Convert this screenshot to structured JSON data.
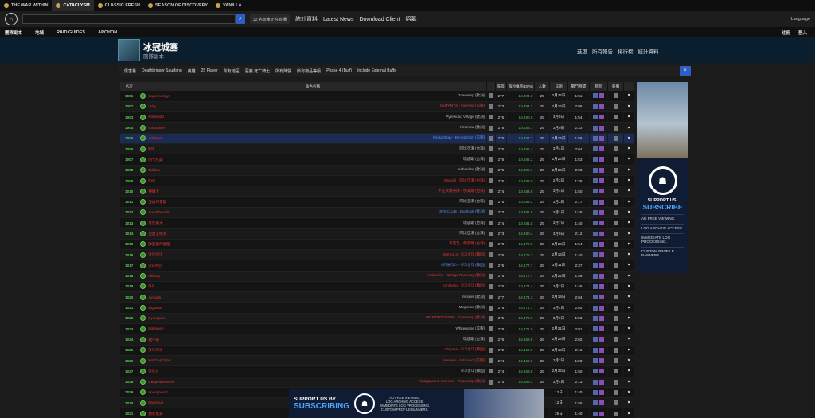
{
  "topbar": {
    "items": [
      {
        "label": "THE WAR WITHIN",
        "active": false
      },
      {
        "label": "CATACLYSM",
        "active": true
      },
      {
        "label": "CLASSIC FRESH",
        "active": false
      },
      {
        "label": "SEASON OF DISCOVERY",
        "active": false
      },
      {
        "label": "VANILLA",
        "active": false
      }
    ]
  },
  "mainnav": {
    "live": "32 名玩家正在直播",
    "links": [
      "統計資料",
      "Latest News",
      "Download Client",
      "招募"
    ],
    "language": "Language"
  },
  "subnav": {
    "items": [
      "團隊副本",
      "地城",
      "RAID GUIDES",
      "ARCHON"
    ],
    "right": [
      "註冊",
      "登入"
    ]
  },
  "zone": {
    "title": "冰冠城塞",
    "subtitle": "團隊副本",
    "links": [
      "進度",
      "所有報告",
      "排行榜",
      "統計資料"
    ]
  },
  "filters": [
    "傷害量",
    "Deathbringer Saurfang",
    "英雄",
    "25 Player",
    "所有地區",
    "惡魔 死亡騎士",
    "所有陣營",
    "所有物品等級",
    "Phase 4 (Buff)",
    "Include External Buffs"
  ],
  "table": {
    "headers": [
      "名次",
      "角色名稱",
      "",
      "裝等",
      "每秒傷害(DPS)",
      "人數",
      "日期",
      "戰鬥時間",
      "飾品",
      "裝備",
      ""
    ],
    "rows": [
      {
        "rank": "1001",
        "name": "Варсзлепрус",
        "guild": "Пламегор (歐洲)",
        "gc": "",
        "ilvl": "277",
        "dps": "19,494.8",
        "n": "25",
        "date": "2月22日",
        "time": "1:51"
      },
      {
        "rank": "1002",
        "name": "Lolly",
        "guild": "MUTANTS - Faerlina (美服)",
        "gc": "red",
        "ilvl": "273",
        "dps": "19,494.2",
        "n": "25",
        "date": "2月16日",
        "time": "2:06"
      },
      {
        "rank": "1003",
        "name": "Dotksadd",
        "guild": "Pyrewood Village (歐洲)",
        "gc": "",
        "ilvl": "276",
        "dps": "19,490.8",
        "n": "25",
        "date": "3月8日",
        "time": "1:54"
      },
      {
        "rank": "1004",
        "name": "Rotocarile",
        "guild": "Firemaw (歐洲)",
        "gc": "",
        "ilvl": "276",
        "dps": "19,488.7",
        "n": "25",
        "date": "3月9日",
        "time": "2:22"
      },
      {
        "rank": "1005",
        "name": "Arthemm",
        "guild": "Kinda Okay - Benediction (美服)",
        "gc": "blue",
        "ilvl": "275",
        "dps": "19,487.2",
        "n": "25",
        "date": "2月14日",
        "time": "1:56",
        "hl": true
      },
      {
        "rank": "1006",
        "name": "Bell",
        "guild": "阿比亞漢 (台灣)",
        "gc": "",
        "ilvl": "275",
        "dps": "19,486.4",
        "n": "25",
        "date": "3月4日",
        "time": "2:04"
      },
      {
        "rank": "1007",
        "name": "阿卡托斯",
        "guild": "瑞迪斯 (台灣)",
        "gc": "",
        "ilvl": "276",
        "dps": "19,486.2",
        "n": "25",
        "date": "2月24日",
        "time": "1:53"
      },
      {
        "rank": "1008",
        "name": "Elddea",
        "guild": "Ashenline (歐洲)",
        "gc": "",
        "ilvl": "276",
        "dps": "19,485.1",
        "n": "25",
        "date": "2月26日",
        "time": "2:03"
      },
      {
        "rank": "1009",
        "name": "Ryd",
        "guild": "Mandel - 阿比亞漢 (台灣)",
        "gc": "red",
        "ilvl": "275",
        "dps": "19,483.8",
        "n": "25",
        "date": "2月2日",
        "time": "1:38"
      },
      {
        "rank": "1010",
        "name": "神騎士",
        "guild": "不正式精英隊 - 伊美爾 (台灣)",
        "gc": "red",
        "ilvl": "274",
        "dps": "19,483.8",
        "n": "25",
        "date": "3月4日",
        "time": "1:50"
      },
      {
        "rank": "1011",
        "name": "亞伯特雷斯",
        "guild": "阿比亞漢 (台灣)",
        "gc": "",
        "ilvl": "276",
        "dps": "19,483.2",
        "n": "25",
        "date": "3月3日",
        "time": "2:17"
      },
      {
        "rank": "1012",
        "name": "Anankhevink",
        "guild": "DPS CLUB - Everlook (歐洲)",
        "gc": "blue",
        "ilvl": "273",
        "dps": "19,481.6",
        "n": "25",
        "date": "3月1日",
        "time": "1:46"
      },
      {
        "rank": "1013",
        "name": "死死雷夫",
        "guild": "瑞迪斯 (台灣)",
        "gc": "",
        "ilvl": "274",
        "dps": "19,481.5",
        "n": "25",
        "date": "3月7日",
        "time": "1:40"
      },
      {
        "rank": "1014",
        "name": "亞瑟王傑克",
        "guild": "阿比亞漢 (台灣)",
        "gc": "",
        "ilvl": "273",
        "dps": "19,480.4",
        "n": "25",
        "date": "3月9日",
        "time": "2:12"
      },
      {
        "rank": "1015",
        "name": "歐西斯的覺醒",
        "guild": "不吃乳 - 伊美爾 (台灣)",
        "gc": "red",
        "ilvl": "278",
        "dps": "19,478.8",
        "n": "25",
        "date": "2月24日",
        "time": "1:54"
      },
      {
        "rank": "1016",
        "name": "아이우터",
        "guild": "Eternal 2 - 로크골다 (韓國)",
        "gc": "red",
        "ilvl": "276",
        "dps": "19,478.2",
        "n": "25",
        "date": "2月16日",
        "time": "1:40"
      },
      {
        "rank": "1017",
        "name": "마로트린",
        "guild": "세이몰리스 - 로크골다 (韓國)",
        "gc": "blue",
        "ilvl": "276",
        "dps": "19,477.7",
        "n": "25",
        "date": "3月11日",
        "time": "2:37"
      },
      {
        "rank": "1018",
        "name": "Aliburg",
        "guild": "Avalanche - Mirage Raceway (歐洲)",
        "gc": "red",
        "ilvl": "275",
        "dps": "19,477.7",
        "n": "25",
        "date": "2月22日",
        "time": "1:56"
      },
      {
        "rank": "1019",
        "name": "타로",
        "guild": "Ironlineto - 로크골다 (韓國)",
        "gc": "red",
        "ilvl": "276",
        "dps": "19,474.4",
        "n": "25",
        "date": "3月7日",
        "time": "1:46"
      },
      {
        "rank": "1020",
        "name": "Aircardi",
        "guild": "Venoxis (歐洲)",
        "gc": "",
        "ilvl": "277",
        "dps": "19,474.3",
        "n": "25",
        "date": "2月19日",
        "time": "2:04"
      },
      {
        "rank": "1021",
        "name": "BigBass",
        "guild": "Mograine (歐洲)",
        "gc": "",
        "ilvl": "276",
        "dps": "19,474.1",
        "n": "25",
        "date": "3月4日",
        "time": "2:02"
      },
      {
        "rank": "1022",
        "name": "Руноврев",
        "guild": "DE MONTENIOR - Пламегор (歐洲)",
        "gc": "red",
        "ilvl": "275",
        "dps": "19,473.9",
        "n": "25",
        "date": "3月9日",
        "time": "1:53"
      },
      {
        "rank": "1023",
        "name": "Batsayeri",
        "guild": "Whitemane (美服)",
        "gc": "",
        "ilvl": "278",
        "dps": "19,471.8",
        "n": "25",
        "date": "2月21日",
        "time": "2:01"
      },
      {
        "rank": "1024",
        "name": "龍不惑",
        "guild": "瑞迪斯 (台灣)",
        "gc": "",
        "ilvl": "276",
        "dps": "19,469.5",
        "n": "25",
        "date": "2月29日",
        "time": "2:02"
      },
      {
        "rank": "1025",
        "name": "망이꼬막",
        "guild": "Sbigass - 로크골다 (韓國)",
        "gc": "red",
        "ilvl": "272",
        "dps": "19,469.0",
        "n": "25",
        "date": "3月13日",
        "time": "2:16"
      },
      {
        "rank": "1026",
        "name": "Ketchupchips",
        "guild": "Heaven - Ashkandi (美服)",
        "gc": "red",
        "ilvl": "274",
        "dps": "19,468.9",
        "n": "25",
        "date": "2月2日",
        "time": "1:58"
      },
      {
        "rank": "1027",
        "name": "마이스",
        "guild": "로크골다 (韓國)",
        "gc": "",
        "ilvl": "274",
        "dps": "19,468.8",
        "n": "25",
        "date": "2月22日",
        "time": "1:50"
      },
      {
        "rank": "1028",
        "name": "Свщенатаннея",
        "guild": "Кавдарский сланник - Пламегор (歐洲)",
        "gc": "red",
        "ilvl": "274",
        "dps": "19,466.3",
        "n": "25",
        "date": "3月4日",
        "time": "2:13"
      },
      {
        "rank": "1029",
        "name": "Чрезвричат",
        "guild": "",
        "gc": "",
        "ilvl": "",
        "dps": "",
        "n": "",
        "date": "12日",
        "time": "1:40"
      },
      {
        "rank": "1030",
        "name": "Faneinus",
        "guild": "",
        "gc": "",
        "ilvl": "",
        "dps": "",
        "n": "",
        "date": "12日",
        "time": "1:55"
      },
      {
        "rank": "1031",
        "name": "蘭尼藍鋒",
        "guild": "",
        "gc": "",
        "ilvl": "",
        "dps": "",
        "n": "",
        "date": "25日",
        "time": "1:40"
      }
    ]
  },
  "sidead": {
    "line1": "SUPPORT US!",
    "line2": "SUBSCRIBE",
    "perks": [
      "AD FREE VIEWING.",
      "LOG ARCHIVE ACCESS.",
      "IMMEDIATE LOG PROCESSING.",
      "CUSTOM PROFILE BANNERS."
    ]
  },
  "botad": {
    "line1": "SUPPORT US BY",
    "line2": "SUBSCRIBING",
    "perks": [
      "AD FREE VIEWING.",
      "LOG ARCHIVE ACCESS.",
      "IMMEDIATE LOG PROCESSING.",
      "CUSTOM PROFILE BANNERS."
    ]
  }
}
